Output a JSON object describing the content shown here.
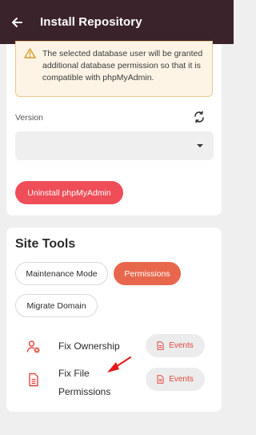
{
  "header": {
    "title": "Install Repository"
  },
  "alert": {
    "text": "The selected database user will be granted additional database permission so that it is compatible with phpMyAdmin."
  },
  "version": {
    "label": "Version",
    "selected": ""
  },
  "uninstall_button": "Uninstall phpMyAdmin",
  "site_tools": {
    "title": "Site Tools",
    "chips": [
      {
        "label": "Maintenance Mode",
        "active": false
      },
      {
        "label": "Permissions",
        "active": true
      },
      {
        "label": "Migrate Domain",
        "active": false
      }
    ],
    "tools": [
      {
        "label": "Fix Ownership",
        "icon": "user-gear-icon",
        "events_label": "Events"
      },
      {
        "label": "Fix File Permissions",
        "icon": "file-icon",
        "events_label": "Events"
      }
    ]
  },
  "colors": {
    "topbar": "#3b232b",
    "uninstall": "#ef4d58",
    "chip_active": "#e8674c",
    "accent_red": "#e0473d",
    "alert_bg": "#fdf4e6",
    "alert_border": "#ecc892"
  }
}
